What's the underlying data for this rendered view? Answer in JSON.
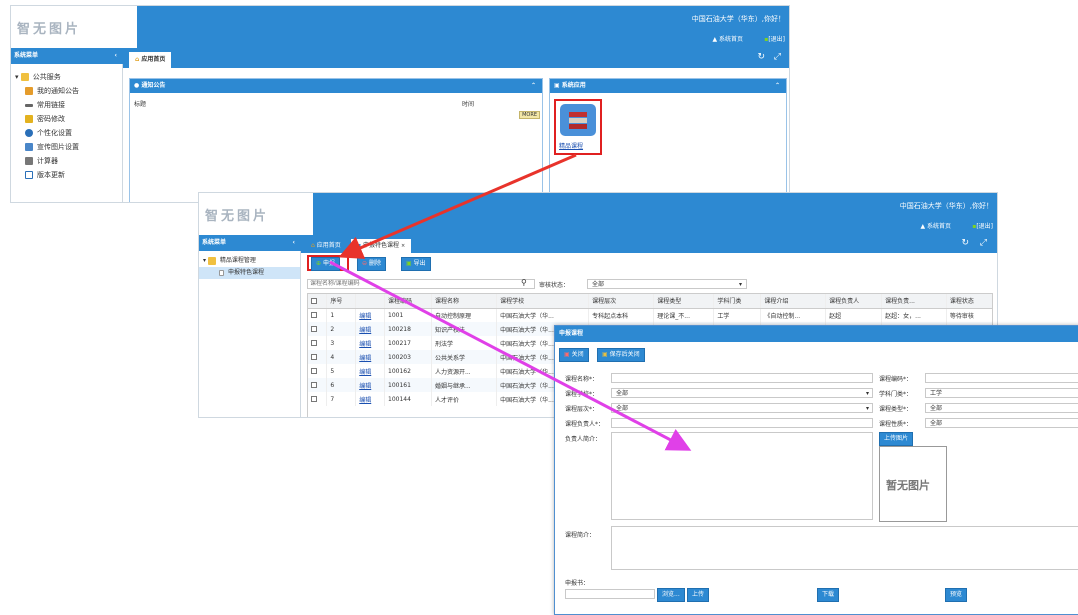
{
  "screen1": {
    "logo": "智无图片",
    "greeting": "中国石油大学（华东）,你好！",
    "home_link": "系统首页",
    "logout_link": "[退出]",
    "sidebar_title": "系统菜单",
    "tab_home": "应用首页",
    "notice_title": "通知公告",
    "col_title": "标题",
    "col_time": "时间",
    "more": "MORE",
    "apps_title": "系统应用",
    "app_label": "精品课程",
    "menu_group": "公共服务",
    "menu": [
      "我的通知公告",
      "常用链接",
      "密码修改",
      "个性化设置",
      "宣传图片设置",
      "计算器",
      "版本更新"
    ]
  },
  "screen2": {
    "logo": "智无图片",
    "greeting": "中国石油大学（华东）,你好！",
    "home_link": "系统首页",
    "logout_link": "[退出]",
    "sidebar_title": "系统菜单",
    "menu_group": "精品课程管理",
    "menu_item": "申报特色课程",
    "tab_home": "应用首页",
    "tab_active": "申报特色课程",
    "btn_apply": "申报",
    "btn_delete": "删除",
    "btn_export": "导出",
    "search_placeholder": "课程名称/课程编码",
    "status_label": "审核状态：",
    "status_value": "全部",
    "columns": [
      "序号",
      "",
      "课程编码",
      "课程名称",
      "课程学校",
      "课程层次",
      "课程类型",
      "学科门类",
      "课程介绍",
      "课程负责人",
      "课程负责...",
      "课程状态"
    ],
    "rows": [
      [
        "1",
        "编辑",
        "1001",
        "自动控制原理",
        "中国石油大学（华...",
        "专科起点本科",
        "理论课_不...",
        "工学",
        "《自动控制...",
        "赵超",
        "赵超：女，...",
        "等待审核"
      ],
      [
        "2",
        "编辑",
        "100218",
        "知识产权法",
        "中国石油大学（华...",
        "",
        "",
        "",
        "",
        "",
        "",
        ""
      ],
      [
        "3",
        "编辑",
        "100217",
        "刑法学",
        "中国石油大学（华...",
        "",
        "",
        "",
        "",
        "",
        "",
        ""
      ],
      [
        "4",
        "编辑",
        "100203",
        "公共关系学",
        "中国石油大学（华...",
        "",
        "",
        "",
        "",
        "",
        "",
        ""
      ],
      [
        "5",
        "编辑",
        "100162",
        "人力资源开...",
        "中国石油大学（华...",
        "",
        "",
        "",
        "",
        "",
        "",
        ""
      ],
      [
        "6",
        "编辑",
        "100161",
        "婚姻与继承...",
        "中国石油大学（华...",
        "",
        "",
        "",
        "",
        "",
        "",
        ""
      ],
      [
        "7",
        "编辑",
        "100144",
        "人才评价",
        "中国石油大学（华...",
        "",
        "",
        "",
        "",
        "",
        "",
        ""
      ]
    ]
  },
  "dialog": {
    "title": "申报课程",
    "btn_close": "关闭",
    "btn_save_close": "保存后关闭",
    "l_name": "课程名称*：",
    "l_school": "课程学校*：",
    "l_level": "课程层次*：",
    "l_owner": "课程负责人*：",
    "l_code": "课程编码*：",
    "l_subject": "学科门类*：",
    "l_type": "课程类型*：",
    "l_nature": "课程性质*：",
    "school_value": "全部",
    "level_value": "全部",
    "subject_value": "工学",
    "type_value": "全部",
    "nature_value": "全部",
    "l_owner_intro": "负责人简介：",
    "upload_photo": "上传图片",
    "no_image": "暂无图片",
    "l_course_intro": "课程简介：",
    "l_application": "申报书：",
    "btn_browse": "浏览...",
    "btn_upload": "上传",
    "btn_download": "下载",
    "btn_preview": "预览"
  },
  "colors": {
    "accent": "#2d89d2",
    "highlight": "#e02020",
    "arrow_red": "#e8332b",
    "arrow_magenta": "#e040e8"
  }
}
